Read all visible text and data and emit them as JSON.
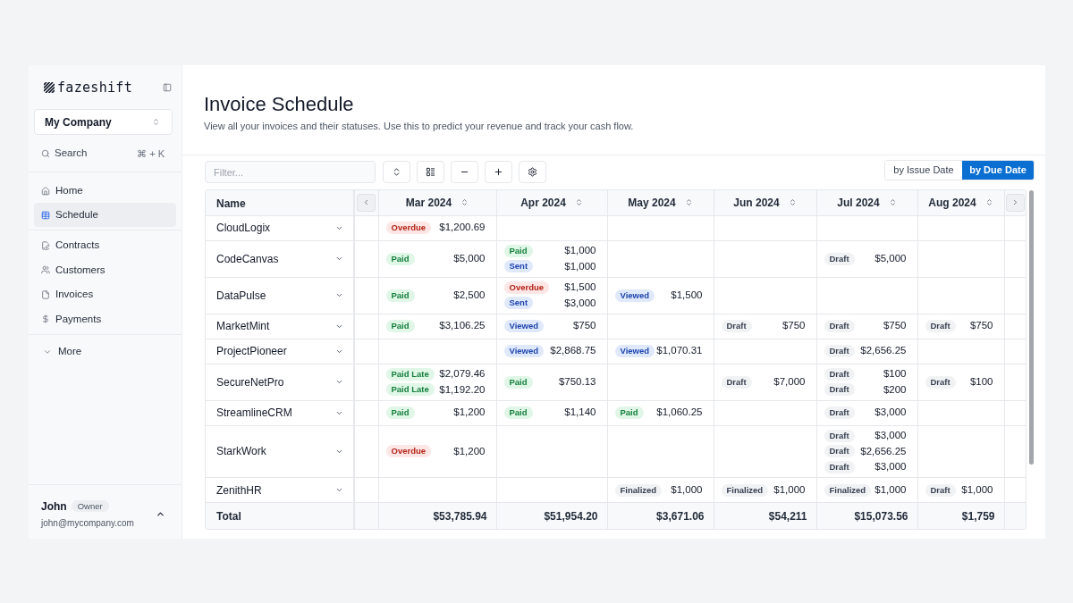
{
  "sidebar": {
    "brand": "fazeshift",
    "company_selector": {
      "value": "My Company"
    },
    "search": {
      "label": "Search",
      "shortcut": "⌘ + K"
    },
    "nav_sections": [
      {
        "items": [
          {
            "label": "Home",
            "selected": false
          },
          {
            "label": "Schedule",
            "selected": true
          }
        ]
      },
      {
        "items": [
          {
            "label": "Contracts",
            "selected": false
          },
          {
            "label": "Customers",
            "selected": false
          },
          {
            "label": "Invoices",
            "selected": false
          },
          {
            "label": "Payments",
            "selected": false
          }
        ]
      }
    ],
    "more": {
      "label": "More",
      "expanded": false
    },
    "user": {
      "name": "John",
      "role": "Owner",
      "email": "john@mycompany.com"
    }
  },
  "page": {
    "title": "Invoice Schedule",
    "subtitle": "View all your invoices and their statuses. Use this to predict your revenue and track your cash flow."
  },
  "toolbar": {
    "filter": {
      "placeholder": "Filter..."
    },
    "date_toggle": [
      {
        "label": "by Issue Date",
        "selected": false
      },
      {
        "label": "by Due Date",
        "selected": true
      }
    ]
  },
  "table": {
    "columns": [
      "Name",
      "Mar 2024",
      "Apr 2024",
      "May 2024",
      "Jun 2024",
      "Jul 2024",
      "Aug 2024"
    ],
    "rows": [
      {
        "cells": [
          {
            "name": "CloudLogix",
            "expanded": false
          },
          {
            "invoices": [
              {
                "status": "Overdue",
                "kind": "danger",
                "amount": "$1,200.69"
              }
            ]
          },
          {},
          {},
          {},
          {},
          {}
        ]
      },
      {
        "cells": [
          {
            "name": "CodeCanvas",
            "expanded": false
          },
          {
            "invoices": [
              {
                "status": "Paid",
                "kind": "success",
                "amount": "$5,000"
              }
            ]
          },
          {
            "invoices": [
              {
                "status": "Paid",
                "kind": "success",
                "amount": "$1,000"
              },
              {
                "status": "Sent",
                "kind": "info",
                "amount": "$1,000"
              }
            ]
          },
          {},
          {},
          {
            "invoices": [
              {
                "status": "Draft",
                "kind": "neutral",
                "amount": "$5,000"
              }
            ]
          },
          {}
        ]
      },
      {
        "cells": [
          {
            "name": "DataPulse",
            "expanded": false
          },
          {
            "invoices": [
              {
                "status": "Paid",
                "kind": "success",
                "amount": "$2,500"
              }
            ]
          },
          {
            "invoices": [
              {
                "status": "Overdue",
                "kind": "danger",
                "amount": "$1,500"
              },
              {
                "status": "Sent",
                "kind": "info",
                "amount": "$3,000"
              }
            ]
          },
          {
            "invoices": [
              {
                "status": "Viewed",
                "kind": "info",
                "amount": "$1,500"
              }
            ]
          },
          {},
          {},
          {}
        ]
      },
      {
        "cells": [
          {
            "name": "MarketMint",
            "expanded": false
          },
          {
            "invoices": [
              {
                "status": "Paid",
                "kind": "success",
                "amount": "$3,106.25"
              }
            ]
          },
          {
            "invoices": [
              {
                "status": "Viewed",
                "kind": "info",
                "amount": "$750"
              }
            ]
          },
          {},
          {
            "invoices": [
              {
                "status": "Draft",
                "kind": "neutral",
                "amount": "$750"
              }
            ]
          },
          {
            "invoices": [
              {
                "status": "Draft",
                "kind": "neutral",
                "amount": "$750"
              }
            ]
          },
          {
            "invoices": [
              {
                "status": "Draft",
                "kind": "neutral",
                "amount": "$750"
              }
            ]
          }
        ]
      },
      {
        "cells": [
          {
            "name": "ProjectPioneer",
            "expanded": false
          },
          {},
          {
            "invoices": [
              {
                "status": "Viewed",
                "kind": "info",
                "amount": "$2,868.75"
              }
            ]
          },
          {
            "invoices": [
              {
                "status": "Viewed",
                "kind": "info",
                "amount": "$1,070.31"
              }
            ]
          },
          {},
          {
            "invoices": [
              {
                "status": "Draft",
                "kind": "neutral",
                "amount": "$2,656.25"
              }
            ]
          },
          {}
        ]
      },
      {
        "cells": [
          {
            "name": "SecureNetPro",
            "expanded": false
          },
          {
            "invoices": [
              {
                "status": "Paid Late",
                "kind": "success",
                "amount": "$2,079.46"
              },
              {
                "status": "Paid Late",
                "kind": "success",
                "amount": "$1,192.20"
              }
            ]
          },
          {
            "invoices": [
              {
                "status": "Paid",
                "kind": "success",
                "amount": "$750.13"
              }
            ]
          },
          {},
          {
            "invoices": [
              {
                "status": "Draft",
                "kind": "neutral",
                "amount": "$7,000"
              }
            ]
          },
          {
            "invoices": [
              {
                "status": "Draft",
                "kind": "neutral",
                "amount": "$100"
              },
              {
                "status": "Draft",
                "kind": "neutral",
                "amount": "$200"
              }
            ]
          },
          {
            "invoices": [
              {
                "status": "Draft",
                "kind": "neutral",
                "amount": "$100"
              }
            ]
          }
        ]
      },
      {
        "cells": [
          {
            "name": "StreamlineCRM",
            "expanded": false
          },
          {
            "invoices": [
              {
                "status": "Paid",
                "kind": "success",
                "amount": "$1,200"
              }
            ]
          },
          {
            "invoices": [
              {
                "status": "Paid",
                "kind": "success",
                "amount": "$1,140"
              }
            ]
          },
          {
            "invoices": [
              {
                "status": "Paid",
                "kind": "success",
                "amount": "$1,060.25"
              }
            ]
          },
          {},
          {
            "invoices": [
              {
                "status": "Draft",
                "kind": "neutral",
                "amount": "$3,000"
              }
            ]
          },
          {}
        ]
      },
      {
        "cells": [
          {
            "name": "StarkWork",
            "expanded": false
          },
          {
            "invoices": [
              {
                "status": "Overdue",
                "kind": "danger",
                "amount": "$1,200"
              }
            ]
          },
          {},
          {},
          {},
          {
            "invoices": [
              {
                "status": "Draft",
                "kind": "neutral",
                "amount": "$3,000"
              },
              {
                "status": "Draft",
                "kind": "neutral",
                "amount": "$2,656.25"
              },
              {
                "status": "Draft",
                "kind": "neutral",
                "amount": "$3,000"
              }
            ]
          },
          {}
        ]
      },
      {
        "cells": [
          {
            "name": "ZenithHR",
            "expanded": false
          },
          {},
          {},
          {
            "invoices": [
              {
                "status": "Finalized",
                "kind": "neutral",
                "amount": "$1,000"
              }
            ]
          },
          {
            "invoices": [
              {
                "status": "Finalized",
                "kind": "neutral",
                "amount": "$1,000"
              }
            ]
          },
          {
            "invoices": [
              {
                "status": "Finalized",
                "kind": "neutral",
                "amount": "$1,000"
              }
            ]
          },
          {
            "invoices": [
              {
                "status": "Draft",
                "kind": "neutral",
                "amount": "$1,000"
              }
            ]
          }
        ]
      }
    ],
    "total": {
      "cells": [
        "Total",
        "$53,785.94",
        "$51,954.20",
        "$3,671.06",
        "$54,211",
        "$15,073.56",
        "$1,759"
      ]
    }
  }
}
